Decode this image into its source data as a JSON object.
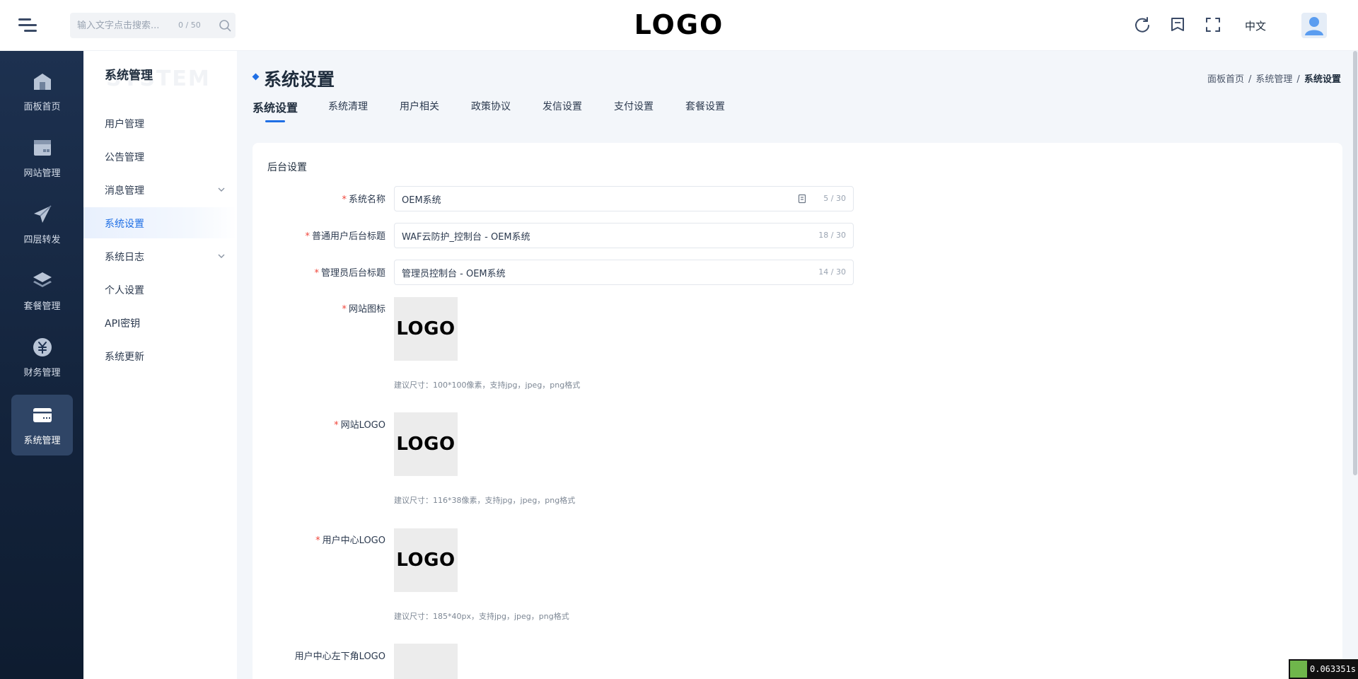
{
  "header": {
    "search": {
      "placeholder": "输入文字点击搜索...",
      "value": "",
      "count": "0 / 50"
    },
    "logo_text": "LOGO",
    "language": "中文"
  },
  "rail": {
    "items": [
      {
        "label": "面板首页",
        "icon": "dashboard-icon"
      },
      {
        "label": "网站管理",
        "icon": "website-icon"
      },
      {
        "label": "四层转发",
        "icon": "send-icon"
      },
      {
        "label": "套餐管理",
        "icon": "layers-icon"
      },
      {
        "label": "财务管理",
        "icon": "yuan-icon"
      },
      {
        "label": "系统管理",
        "icon": "system-icon",
        "active": true
      }
    ]
  },
  "subnav": {
    "title": "系统管理",
    "watermark": "SYSTEM",
    "items": [
      {
        "label": "用户管理"
      },
      {
        "label": "公告管理"
      },
      {
        "label": "消息管理",
        "expandable": true
      },
      {
        "label": "系统设置",
        "active": true
      },
      {
        "label": "系统日志",
        "expandable": true
      },
      {
        "label": "个人设置"
      },
      {
        "label": "API密钥"
      },
      {
        "label": "系统更新"
      }
    ]
  },
  "main": {
    "title": "系统设置",
    "breadcrumb": [
      "面板首页",
      "系统管理",
      "系统设置"
    ],
    "tabs": [
      "系统设置",
      "系统清理",
      "用户相关",
      "政策协议",
      "发信设置",
      "支付设置",
      "套餐设置"
    ],
    "active_tab": "系统设置",
    "section_title": "后台设置",
    "fields": {
      "system_name": {
        "label": "系统名称",
        "value": "OEM系统",
        "count": "5 / 30",
        "required": true
      },
      "user_title": {
        "label": "普通用户后台标题",
        "value": "WAF云防护_控制台 - OEM系统",
        "count": "18 / 30",
        "required": true
      },
      "admin_title": {
        "label": "管理员后台标题",
        "value": "管理员控制台 - OEM系统",
        "count": "14 / 30",
        "required": true
      },
      "favicon": {
        "label": "网站图标",
        "image_text": "LOGO",
        "hint": "建议尺寸：100*100像素，支持jpg，jpeg，png格式",
        "required": true
      },
      "site_logo": {
        "label": "网站LOGO",
        "image_text": "LOGO",
        "hint": "建议尺寸：116*38像素，支持jpg，jpeg，png格式",
        "required": true
      },
      "user_logo": {
        "label": "用户中心LOGO",
        "image_text": "LOGO",
        "hint": "建议尺寸：185*40px，支持jpg，jpeg，png格式",
        "required": true
      },
      "user_corner_logo": {
        "label": "用户中心左下角LOGO"
      }
    }
  },
  "timer": "0.063351s",
  "colors": {
    "accent": "#1f6fe5",
    "rail_bg": "#13233b",
    "required": "#f0453a"
  }
}
